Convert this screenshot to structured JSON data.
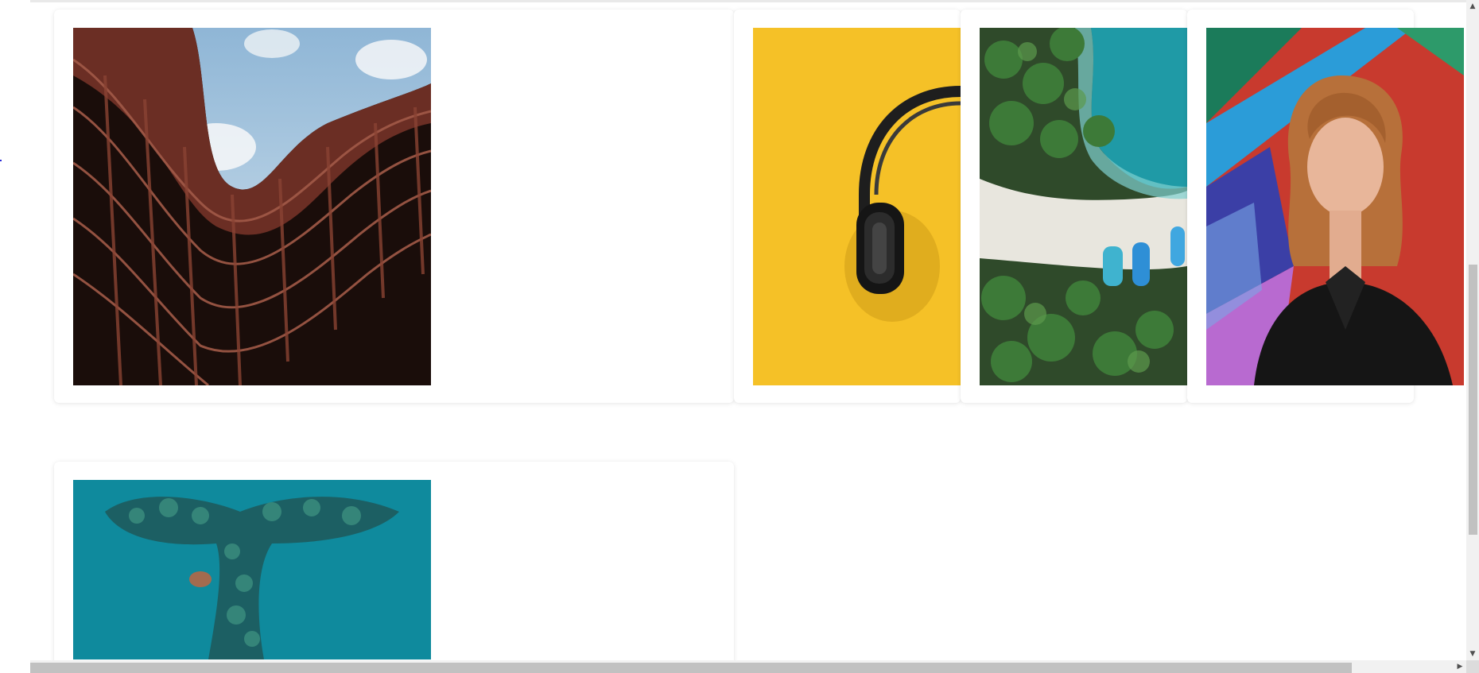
{
  "gallery": {
    "photos": [
      {
        "subject": "curved-building-icon"
      },
      {
        "subject": "headphones-icon"
      },
      {
        "subject": "beach-palms-icon"
      },
      {
        "subject": "portrait-graffiti-icon"
      },
      {
        "subject": "coral-reef-icon"
      }
    ]
  },
  "scrollbars": {
    "up_arrow": "▲",
    "down_arrow": "▼",
    "right_arrow": "▶"
  },
  "colors": {
    "page_background": "#ffffff",
    "card_background": "#ffffff",
    "scroll_track": "#f1f1f1",
    "scroll_thumb": "#c1c1c1",
    "headphones_bg": "#f7c72e",
    "reef_water": "#0f7f93"
  }
}
